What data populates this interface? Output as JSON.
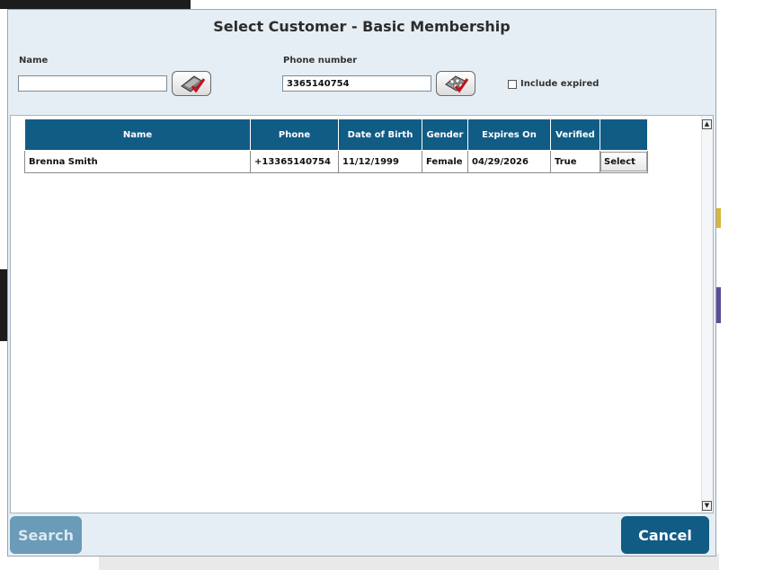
{
  "dialog": {
    "title": "Select Customer - Basic Membership"
  },
  "filters": {
    "name_label": "Name",
    "name_value": "",
    "phone_label": "Phone number",
    "phone_value": "3365140754",
    "include_expired_label": "Include expired",
    "include_expired_checked": false
  },
  "grid": {
    "columns": [
      "Name",
      "Phone",
      "Date of Birth",
      "Gender",
      "Expires On",
      "Verified",
      ""
    ],
    "rows": [
      {
        "name": "Brenna Smith",
        "phone": "+13365140754",
        "dob": "11/12/1999",
        "gender": "Female",
        "expires": "04/29/2026",
        "verified": "True",
        "action": "Select"
      }
    ]
  },
  "footer": {
    "search_label": "Search",
    "cancel_label": "Cancel"
  },
  "colors": {
    "header_bg": "#115c85",
    "dialog_bg": "#e6eef5",
    "search_disabled_bg": "#6a9bb8"
  },
  "icons": {
    "name_keyboard": "keyboard-check-icon",
    "phone_keypad": "keypad-check-icon"
  }
}
